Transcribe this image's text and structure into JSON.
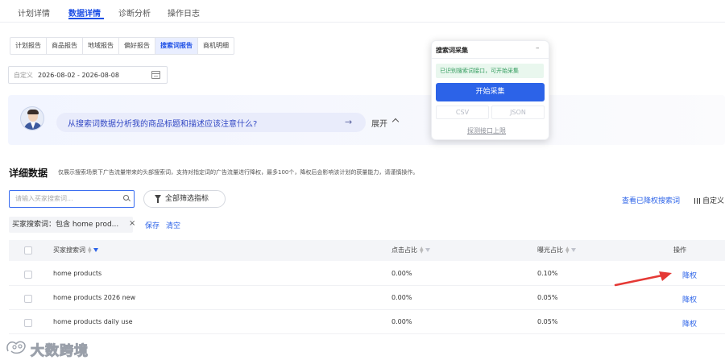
{
  "top_tabs": [
    {
      "label": "计划详情"
    },
    {
      "label": "数据详情"
    },
    {
      "label": "诊断分析"
    },
    {
      "label": "操作日志"
    }
  ],
  "report_tabs": [
    {
      "label": "计划报告"
    },
    {
      "label": "商品报告"
    },
    {
      "label": "地域报告"
    },
    {
      "label": "偏好报告"
    },
    {
      "label": "搜索词报告"
    },
    {
      "label": "商机明细"
    }
  ],
  "date": {
    "prefix": "自定义",
    "value": "2026-08-02 - 2026-08-08"
  },
  "ai": {
    "question": "从搜索词数据分析我的商品标题和描述应该注意什么?",
    "arrow": "→",
    "expand": "展开"
  },
  "popup": {
    "title": "搜索词采集",
    "minimize": "–",
    "status": "已识别搜索词接口，可开始采集",
    "start": "开始采集",
    "csv": "CSV",
    "json": "JSON",
    "link": "探测接口上限"
  },
  "detail": {
    "title": "详细数据",
    "desc": "仅展示搜索场景下广告流量带来的头部搜索词，支持对指定词的广告流量进行降权，最多100个，降权后会影响该计划的获量能力，请谨慎操作。"
  },
  "search": {
    "placeholder": "请输入买家搜索词..."
  },
  "filter": {
    "label": "全部筛选指标"
  },
  "links": {
    "reduced": "查看已降权搜索词",
    "custom": "自定义"
  },
  "chip": {
    "label": "买家搜索词：包含 home prod...",
    "close": "×",
    "save": "保存",
    "clear": "清空"
  },
  "table": {
    "headers": {
      "keyword": "买家搜索词",
      "click": "点击占比",
      "exposure": "曝光占比",
      "action": "操作"
    },
    "rows": [
      {
        "keyword": "home products",
        "click": "0.00%",
        "exposure": "0.10%",
        "action": "降权"
      },
      {
        "keyword": "home products 2026 new",
        "click": "0.00%",
        "exposure": "0.05%",
        "action": "降权"
      },
      {
        "keyword": "home products daily use",
        "click": "0.00%",
        "exposure": "0.05%",
        "action": "降权"
      }
    ]
  },
  "watermark": {
    "text": "大数跨境"
  },
  "colors": {
    "accent": "#1e50e6",
    "annotation": "#e53935"
  }
}
